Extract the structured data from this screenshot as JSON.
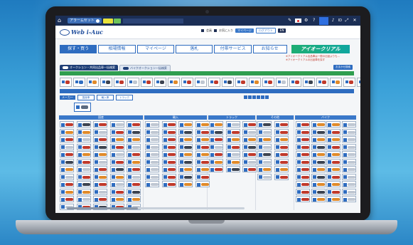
{
  "titlebar": {
    "alert_label": "アラームセット",
    "user_label": "ID"
  },
  "header": {
    "logo_text": "Web i-Auc",
    "util_1": "会員",
    "util_2": "お気に入り",
    "btn_1": "マイページ",
    "btn_2": "ログアウト",
    "btn_3": "EN"
  },
  "nav": {
    "tabs": [
      {
        "label": "探す・買う",
        "active": true
      },
      {
        "label": "相場情報",
        "active": false
      },
      {
        "label": "マイページ",
        "active": false
      },
      {
        "label": "落札",
        "active": false
      },
      {
        "label": "付帯サービス",
        "active": false
      },
      {
        "label": "お知らせ",
        "active": false
      }
    ],
    "brand_label": "アイオークリアル"
  },
  "notice": {
    "line1": "※アイオークリアル出品車は一般の出品よりも…",
    "line2": "※アイオークリアルの出品車を探す"
  },
  "subtabs": [
    {
      "label": "オークション・共同出品車一括検索",
      "style": "dark"
    },
    {
      "label": "バイクオークション一括検索",
      "style": "light"
    }
  ],
  "green_bar": {
    "right_button": "おまかせ検索"
  },
  "filter": {
    "label": "メーカー",
    "btn_1": "国産車",
    "btn_2": "輸入車",
    "btn_3": "トラック"
  },
  "columns": [
    {
      "header": "国産",
      "rows": 24
    },
    {
      "header": "輸入",
      "rows": 16
    },
    {
      "header": "トラック",
      "rows": 14
    },
    {
      "header": "その他",
      "rows": 12
    },
    {
      "header": "バイク",
      "rows": 20
    }
  ],
  "colors": {
    "primary": "#2e6cc0",
    "titlebar": "#1b2e55",
    "green": "#2f9e4f",
    "brand_red": "#e33c3c"
  }
}
